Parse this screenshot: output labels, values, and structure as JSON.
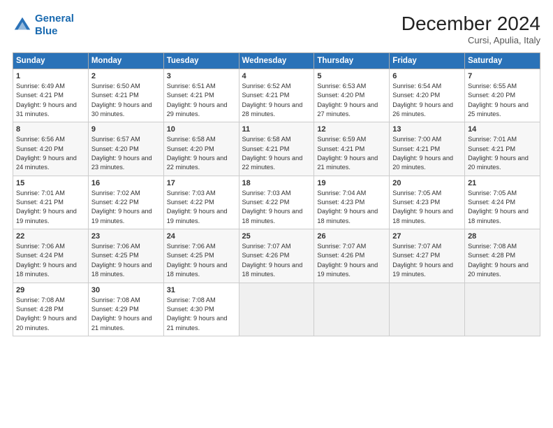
{
  "header": {
    "logo_line1": "General",
    "logo_line2": "Blue",
    "month": "December 2024",
    "location": "Cursi, Apulia, Italy"
  },
  "days_of_week": [
    "Sunday",
    "Monday",
    "Tuesday",
    "Wednesday",
    "Thursday",
    "Friday",
    "Saturday"
  ],
  "weeks": [
    [
      {
        "day": 1,
        "sunrise": "6:49 AM",
        "sunset": "4:21 PM",
        "daylight": "9 hours and 31 minutes."
      },
      {
        "day": 2,
        "sunrise": "6:50 AM",
        "sunset": "4:21 PM",
        "daylight": "9 hours and 30 minutes."
      },
      {
        "day": 3,
        "sunrise": "6:51 AM",
        "sunset": "4:21 PM",
        "daylight": "9 hours and 29 minutes."
      },
      {
        "day": 4,
        "sunrise": "6:52 AM",
        "sunset": "4:21 PM",
        "daylight": "9 hours and 28 minutes."
      },
      {
        "day": 5,
        "sunrise": "6:53 AM",
        "sunset": "4:20 PM",
        "daylight": "9 hours and 27 minutes."
      },
      {
        "day": 6,
        "sunrise": "6:54 AM",
        "sunset": "4:20 PM",
        "daylight": "9 hours and 26 minutes."
      },
      {
        "day": 7,
        "sunrise": "6:55 AM",
        "sunset": "4:20 PM",
        "daylight": "9 hours and 25 minutes."
      }
    ],
    [
      {
        "day": 8,
        "sunrise": "6:56 AM",
        "sunset": "4:20 PM",
        "daylight": "9 hours and 24 minutes."
      },
      {
        "day": 9,
        "sunrise": "6:57 AM",
        "sunset": "4:20 PM",
        "daylight": "9 hours and 23 minutes."
      },
      {
        "day": 10,
        "sunrise": "6:58 AM",
        "sunset": "4:20 PM",
        "daylight": "9 hours and 22 minutes."
      },
      {
        "day": 11,
        "sunrise": "6:58 AM",
        "sunset": "4:21 PM",
        "daylight": "9 hours and 22 minutes."
      },
      {
        "day": 12,
        "sunrise": "6:59 AM",
        "sunset": "4:21 PM",
        "daylight": "9 hours and 21 minutes."
      },
      {
        "day": 13,
        "sunrise": "7:00 AM",
        "sunset": "4:21 PM",
        "daylight": "9 hours and 20 minutes."
      },
      {
        "day": 14,
        "sunrise": "7:01 AM",
        "sunset": "4:21 PM",
        "daylight": "9 hours and 20 minutes."
      }
    ],
    [
      {
        "day": 15,
        "sunrise": "7:01 AM",
        "sunset": "4:21 PM",
        "daylight": "9 hours and 19 minutes."
      },
      {
        "day": 16,
        "sunrise": "7:02 AM",
        "sunset": "4:22 PM",
        "daylight": "9 hours and 19 minutes."
      },
      {
        "day": 17,
        "sunrise": "7:03 AM",
        "sunset": "4:22 PM",
        "daylight": "9 hours and 19 minutes."
      },
      {
        "day": 18,
        "sunrise": "7:03 AM",
        "sunset": "4:22 PM",
        "daylight": "9 hours and 18 minutes."
      },
      {
        "day": 19,
        "sunrise": "7:04 AM",
        "sunset": "4:23 PM",
        "daylight": "9 hours and 18 minutes."
      },
      {
        "day": 20,
        "sunrise": "7:05 AM",
        "sunset": "4:23 PM",
        "daylight": "9 hours and 18 minutes."
      },
      {
        "day": 21,
        "sunrise": "7:05 AM",
        "sunset": "4:24 PM",
        "daylight": "9 hours and 18 minutes."
      }
    ],
    [
      {
        "day": 22,
        "sunrise": "7:06 AM",
        "sunset": "4:24 PM",
        "daylight": "9 hours and 18 minutes."
      },
      {
        "day": 23,
        "sunrise": "7:06 AM",
        "sunset": "4:25 PM",
        "daylight": "9 hours and 18 minutes."
      },
      {
        "day": 24,
        "sunrise": "7:06 AM",
        "sunset": "4:25 PM",
        "daylight": "9 hours and 18 minutes."
      },
      {
        "day": 25,
        "sunrise": "7:07 AM",
        "sunset": "4:26 PM",
        "daylight": "9 hours and 18 minutes."
      },
      {
        "day": 26,
        "sunrise": "7:07 AM",
        "sunset": "4:26 PM",
        "daylight": "9 hours and 19 minutes."
      },
      {
        "day": 27,
        "sunrise": "7:07 AM",
        "sunset": "4:27 PM",
        "daylight": "9 hours and 19 minutes."
      },
      {
        "day": 28,
        "sunrise": "7:08 AM",
        "sunset": "4:28 PM",
        "daylight": "9 hours and 20 minutes."
      }
    ],
    [
      {
        "day": 29,
        "sunrise": "7:08 AM",
        "sunset": "4:28 PM",
        "daylight": "9 hours and 20 minutes."
      },
      {
        "day": 30,
        "sunrise": "7:08 AM",
        "sunset": "4:29 PM",
        "daylight": "9 hours and 21 minutes."
      },
      {
        "day": 31,
        "sunrise": "7:08 AM",
        "sunset": "4:30 PM",
        "daylight": "9 hours and 21 minutes."
      },
      null,
      null,
      null,
      null
    ]
  ]
}
